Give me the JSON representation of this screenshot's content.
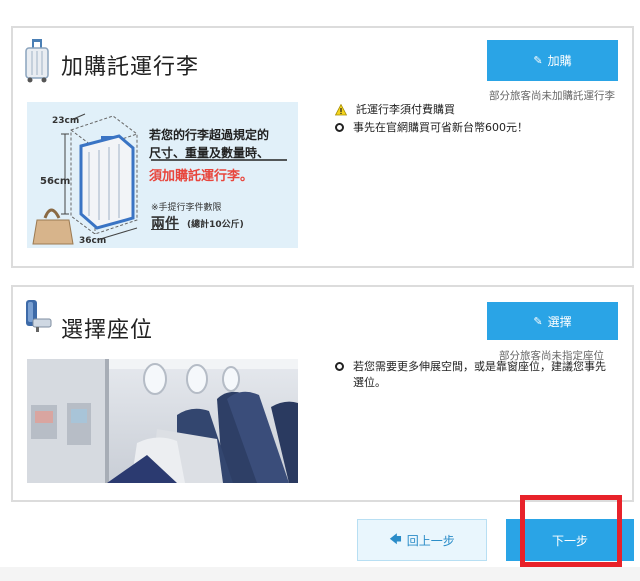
{
  "baggage": {
    "title": "加購託運行李",
    "button_label": "加購",
    "button_note": "部分旅客尚未加購託運行李",
    "notices": [
      "託運行李須付費購買",
      "事先在官網購買可省新台幣600元！"
    ],
    "banner": {
      "dim_height": "56cm",
      "dim_depth": "23cm",
      "dim_width": "36cm",
      "line1": "若您的行李超過規定的",
      "line2": "尺寸、重量及數量時、",
      "line3": "須加購託運行李。",
      "carry_note": "※手提行李件數限",
      "carry_count": "兩件",
      "carry_total": "(總計10公斤)"
    }
  },
  "seat": {
    "title": "選擇座位",
    "button_label": "選擇",
    "button_note": "部分旅客尚未指定座位",
    "notice": "若您需要更多伸展空間，或是靠窗座位，建議您事先選位。"
  },
  "nav": {
    "back_label": "回上一步",
    "next_label": "下一步"
  },
  "colors": {
    "accent": "#2aa4e6",
    "highlight": "#e8222a",
    "warning": "#f4d41e"
  }
}
